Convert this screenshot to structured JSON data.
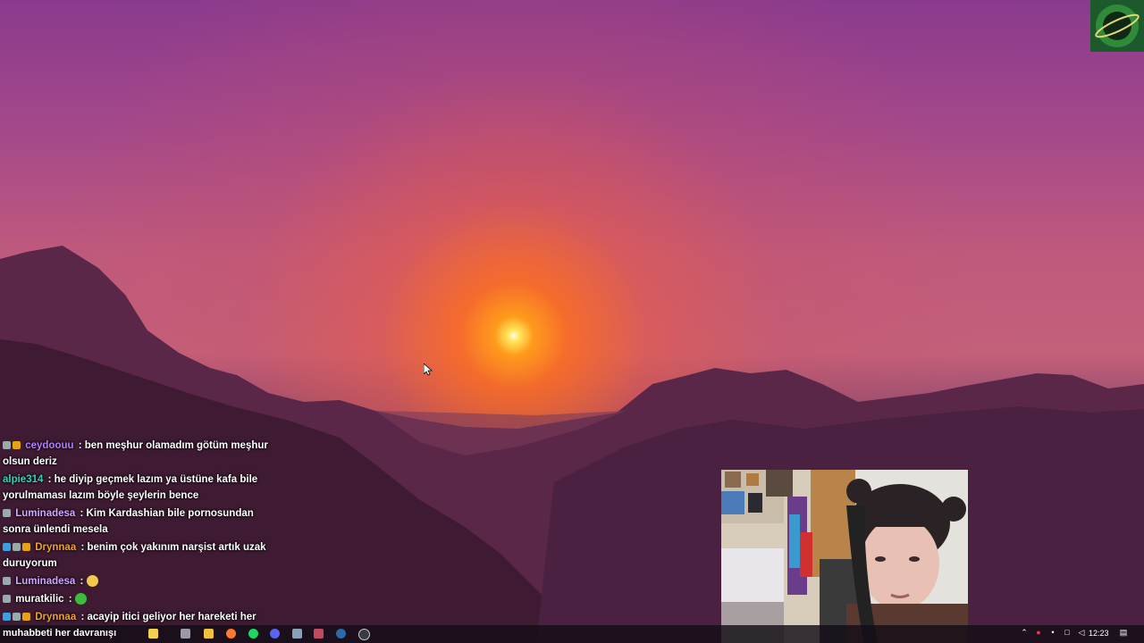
{
  "chat": {
    "messages": [
      {
        "user": "ceydoouu",
        "user_color": "#b57cff",
        "text": ": ben meşhur olamadım götüm meşhur olsun deriz",
        "badges": [
          "gray",
          "gold"
        ]
      },
      {
        "user": "alpie314",
        "user_color": "#2fd4b8",
        "text": ": he diyip geçmek lazım ya üstüne kafa bile yorulmaması lazım böyle şeylerin bence",
        "badges": []
      },
      {
        "user": "Luminadesa",
        "user_color": "#d0a8ff",
        "text": ": Kim Kardashian bile pornosundan sonra ünlendi mesela",
        "badges": [
          "gray"
        ]
      },
      {
        "user": "Drynnaa",
        "user_color": "#f0a030",
        "text": ": benim çok yakınım narşist artık uzak duruyorum",
        "badges": [
          "blue",
          "gray",
          "gold"
        ]
      },
      {
        "user": "Luminadesa",
        "user_color": "#d0a8ff",
        "text": ":",
        "badges": [
          "gray"
        ],
        "emote_color": "#f2c94c"
      },
      {
        "user": "muratkilic",
        "user_color": "#ffffff",
        "text": ":",
        "badges": [
          "gray"
        ],
        "emote_color": "#3dbb3d"
      },
      {
        "user": "Drynnaa",
        "user_color": "#f0a030",
        "text": ": acayip itici geliyor her hareketi her",
        "badges": [
          "blue",
          "gray",
          "gold"
        ]
      }
    ]
  },
  "taskbar": {
    "search_text": "muhabbeti her davranışı",
    "clock": "12:23",
    "icons": [
      "sparkle-icon",
      "task-view-icon",
      "file-explorer-icon",
      "firefox-icon",
      "spotify-icon",
      "discord-icon",
      "app-icon",
      "shield-app-icon",
      "steam-icon",
      "obs-icon"
    ],
    "tray": [
      "chevron-up-icon",
      "record-icon",
      "microphone-icon",
      "network-icon",
      "volume-icon",
      "notification-icon"
    ]
  },
  "colors": {
    "sky_top": "#8a3a8e",
    "sun": "#ffe45a",
    "taskbar": "#140e16"
  }
}
